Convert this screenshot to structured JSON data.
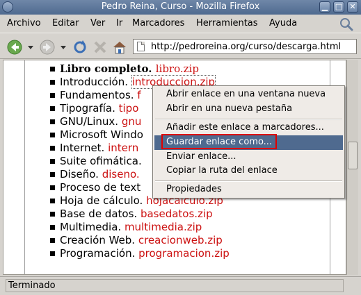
{
  "window": {
    "title": "Pedro Reina, Curso - Mozilla Firefox"
  },
  "menubar": [
    "Archivo",
    "Editar",
    "Ver",
    "Ir",
    "Marcadores",
    "Herramientas",
    "Ayuda"
  ],
  "toolbar": {
    "url": "http://pedroreina.org/curso/descarga.html"
  },
  "content": {
    "items": [
      {
        "label": "Libro completo. ",
        "link": "libro.zip"
      },
      {
        "label": "Introducción. ",
        "link": "introduccion.zip"
      },
      {
        "label": "Fundamentos. ",
        "link": "f"
      },
      {
        "label": "Tipografía. ",
        "link": "tipo"
      },
      {
        "label": "GNU/Linux. ",
        "link": "gnu"
      },
      {
        "label": "Microsoft Windo",
        "link": ""
      },
      {
        "label": "Internet. ",
        "link": "intern"
      },
      {
        "label": "Suite ofimática. ",
        "link": ""
      },
      {
        "label": "Diseño. ",
        "link": "diseno."
      },
      {
        "label": "Proceso de text",
        "link": ""
      },
      {
        "label": "Hoja de cálculo. ",
        "link": "hojacalculo.zip"
      },
      {
        "label": "Base de datos. ",
        "link": "basedatos.zip"
      },
      {
        "label": "Multimedia. ",
        "link": "multimedia.zip"
      },
      {
        "label": "Creación Web. ",
        "link": "creacionweb.zip"
      },
      {
        "label": "Programación. ",
        "link": "programacion.zip"
      }
    ]
  },
  "context_menu": {
    "open_new_window": "Abrir enlace en una ventana nueva",
    "open_new_tab": "Abrir en una nueva pestaña",
    "bookmark_link": "Añadir este enlace a marcadores...",
    "save_link_as": "Guardar enlace como...",
    "send_link": "Enviar enlace...",
    "copy_link": "Copiar la ruta del enlace",
    "properties": "Propiedades"
  },
  "status": {
    "text": "Terminado"
  },
  "colors": {
    "link": "#cc1111",
    "titlebar": "#4f6a8f",
    "highlight": "#4f6a8f",
    "annotation": "#e00000"
  }
}
